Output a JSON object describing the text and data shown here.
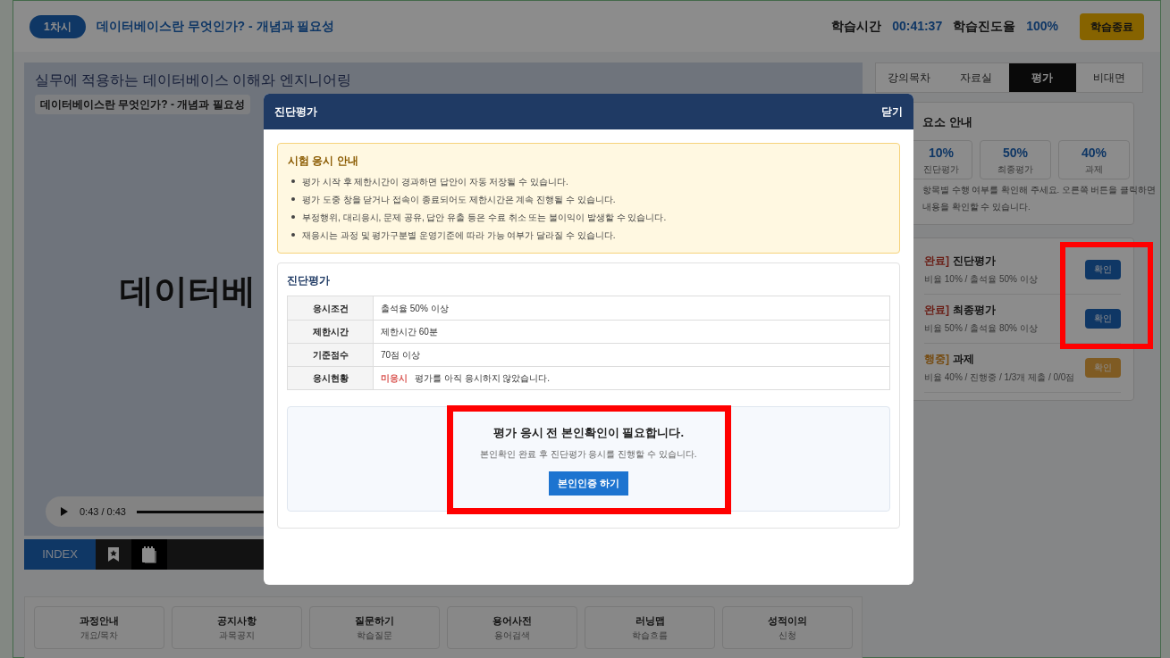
{
  "header": {
    "session": "1차시",
    "lesson_title": "데이터베이스란 무엇인가? - 개념과 필요성",
    "time_label": "학습시간",
    "time": "00:41:37",
    "progress_label": "학습진도율",
    "progress": "100%",
    "end_button": "학습종료"
  },
  "video": {
    "course_title": "실무에 적용하는 데이터베이스 이해와 엔지니어링",
    "chip": "데이터베이스란 무엇인가? - 개념과 필요성",
    "slide_text": "데이터베",
    "time": "0:43 / 0:43",
    "level": 1
  },
  "toolbar": {
    "index": "INDEX",
    "tools": [
      {
        "kind": "bookmark",
        "selected": false
      },
      {
        "kind": "note",
        "selected": true
      }
    ]
  },
  "bottom_menu": [
    {
      "title": "과정안내",
      "subtitle": "개요/목차"
    },
    {
      "title": "공지사항",
      "subtitle": "과목공지"
    },
    {
      "title": "질문하기",
      "subtitle": "학습질문"
    },
    {
      "title": "용어사전",
      "subtitle": "용어검색"
    },
    {
      "title": "러닝맵",
      "subtitle": "학습흐름"
    },
    {
      "title": "성적이의",
      "subtitle": "신청"
    }
  ],
  "side_tabs": [
    {
      "label": "강의목차",
      "selected": false
    },
    {
      "label": "자료실",
      "selected": false
    },
    {
      "label": "평가",
      "selected": true
    },
    {
      "label": "비대면",
      "selected": false
    }
  ],
  "weights": {
    "title": "요소 안내",
    "items": [
      {
        "value": "10%",
        "label": "진단평가"
      },
      {
        "value": "50%",
        "label": "최종평가"
      },
      {
        "value": "40%",
        "label": "과제"
      }
    ],
    "note_lines": [
      "항목별 수행 여부를 확인해 주세요. 오른쪽 버튼을 클릭하면",
      "내용을 확인할 수 있습니다."
    ]
  },
  "evaluations": [
    {
      "status": "완료]",
      "kind": "done",
      "title": "진단평가",
      "detail": "비율 10% / 출석율 50% 이상",
      "button": "확인",
      "highlighted": true
    },
    {
      "status": "완료]",
      "kind": "done",
      "title": "최종평가",
      "detail": "비율 50% / 출석율 80% 이상",
      "button": "확인",
      "highlighted": true
    },
    {
      "status": "행중]",
      "kind": "progress",
      "title": "과제",
      "detail": "비율 40% / 진행중 / 1/3개 제출 / 0/0점",
      "button": "확인",
      "highlighted": false
    }
  ],
  "modal": {
    "title": "진단평가",
    "close": "닫기",
    "notice": {
      "title": "시험 응시 안내",
      "items": [
        "평가 시작 후 제한시간이 경과하면 답안이 자동 저장될 수 있습니다.",
        "평가 도중 창을 닫거나 접속이 종료되어도 제한시간은 계속 진행될 수 있습니다.",
        "부정행위, 대리응시, 문제 공유, 답안 유출 등은 수료 취소 또는 불이익이 발생할 수 있습니다.",
        "재응시는 과정 및 평가구분별 운영기준에 따라 가능 여부가 달라질 수 있습니다."
      ]
    },
    "section_title": "진단평가",
    "rows": [
      {
        "label": "응시조건",
        "value": "출석율 50% 이상"
      },
      {
        "label": "제한시간",
        "value": "제한시간 60분"
      },
      {
        "label": "기준점수",
        "value": "70점 이상"
      },
      {
        "label": "응시현황",
        "status": "미응시",
        "value": "평가를 아직 응시하지 않았습니다."
      }
    ],
    "verify": {
      "title": "평가 응시 전 본인확인이 필요합니다.",
      "text": "본인확인 완료 후 진단평가 응시를 진행할 수 있습니다.",
      "button": "본인인증 하기",
      "highlighted": true
    }
  }
}
